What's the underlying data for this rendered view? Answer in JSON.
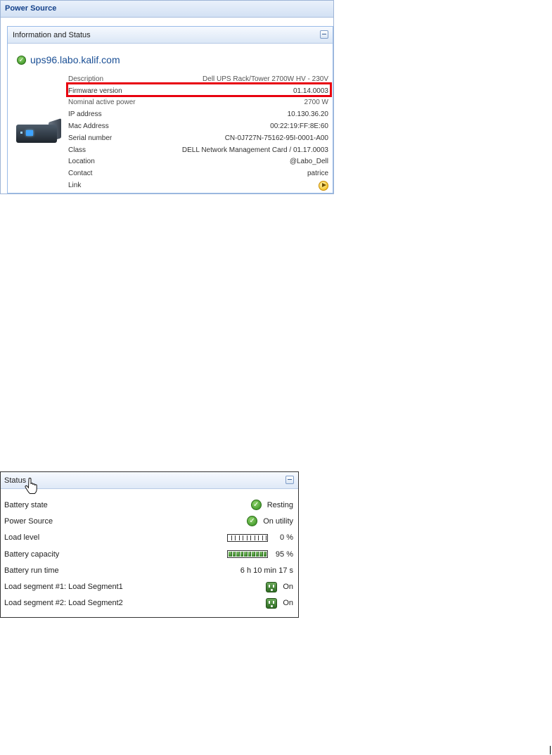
{
  "power_source_panel": {
    "title": "Power Source",
    "info_status": {
      "title": "Information and Status",
      "host": "ups96.labo.kalif.com",
      "rows": [
        {
          "label": "Description",
          "value": "Dell UPS Rack/Tower 2700W HV - 230V"
        },
        {
          "label": "Firmware version",
          "value": "01.14.0003"
        },
        {
          "label": "Nominal active power",
          "value": "2700 W"
        },
        {
          "label": "IP address",
          "value": "10.130.36.20"
        },
        {
          "label": "Mac Address",
          "value": "00:22:19:FF:8E:60"
        },
        {
          "label": "Serial number",
          "value": "CN-0J727N-75162-95I-0001-A00"
        },
        {
          "label": "Class",
          "value": "DELL Network Management Card / 01.17.0003"
        },
        {
          "label": "Location",
          "value": "@Labo_Dell"
        },
        {
          "label": "Contact",
          "value": "patrice"
        },
        {
          "label": "Link",
          "value": ""
        }
      ]
    }
  },
  "status_panel": {
    "title": "Status",
    "rows": [
      {
        "label": "Battery state",
        "value": "Resting"
      },
      {
        "label": "Power Source",
        "value": "On utility"
      },
      {
        "label": "Load level",
        "value": "0 %",
        "level": 0
      },
      {
        "label": "Battery capacity",
        "value": "95 %",
        "level": 95
      },
      {
        "label": "Battery run time",
        "value": "6 h 10 min 17 s"
      },
      {
        "label": "Load segment #1: Load Segment1",
        "value": "On"
      },
      {
        "label": "Load segment #2: Load Segment2",
        "value": "On"
      }
    ]
  },
  "colors": {
    "highlight": "#e8000f",
    "ok_green": "#2f8a1c",
    "header_text": "#15428b"
  },
  "icons": [
    "ok-check-icon",
    "collapse-icon",
    "link-arrow-icon",
    "outlet-icon",
    "hand-cursor-icon"
  ]
}
